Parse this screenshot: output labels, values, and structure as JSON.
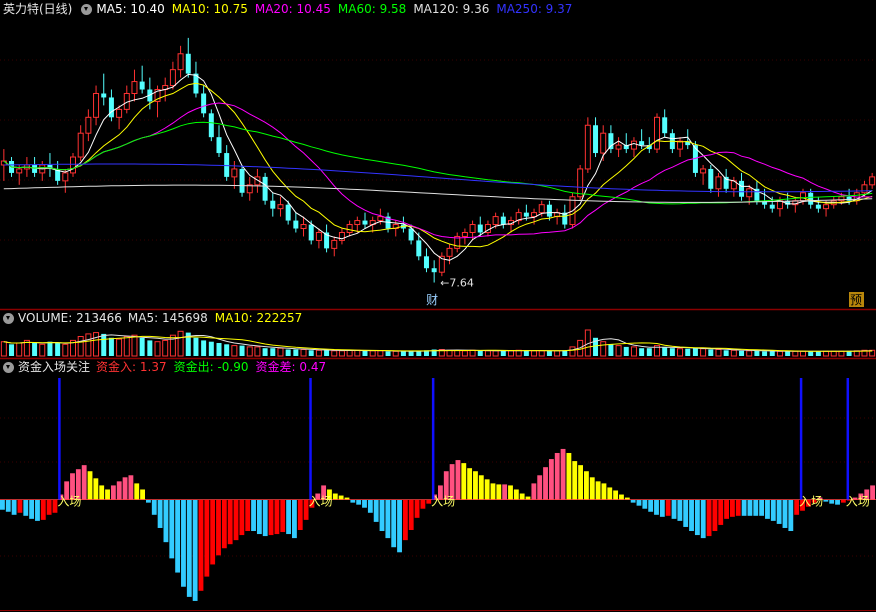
{
  "colors": {
    "up": "#ff3232",
    "down": "#54ffff",
    "bg": "#000000",
    "ma5": "#ffffff",
    "ma10": "#ffff00",
    "ma20": "#ff00ff",
    "ma60": "#00ff00",
    "ma120": "#e0e0e0",
    "ma250": "#3333ff",
    "in": "#ff3232",
    "out": "#00ff00",
    "diff": "#ff00ff",
    "signal": "#1010ff",
    "divider": "#8b0000",
    "grid": "#7a0000"
  },
  "main_legend": {
    "title": "英力特(日线)",
    "items": [
      {
        "text": "MA5: 10.40",
        "color": "#ffffff"
      },
      {
        "text": "MA10: 10.75",
        "color": "#ffff00"
      },
      {
        "text": "MA20: 10.45",
        "color": "#ff00ff"
      },
      {
        "text": "MA60: 9.58",
        "color": "#00ff00"
      },
      {
        "text": "MA120: 9.36",
        "color": "#e0e0e0"
      },
      {
        "text": "MA250: 9.37",
        "color": "#3333ff"
      }
    ]
  },
  "volume_legend": {
    "title": "VOLUME: 213466",
    "items": [
      {
        "text": "MA5: 145698",
        "color": "#e0e0e0"
      },
      {
        "text": "MA10: 222257",
        "color": "#ffff00"
      }
    ]
  },
  "fund_legend": {
    "title": "资金入场关注",
    "items": [
      {
        "text": "资金入: 1.37",
        "color": "#ff3232"
      },
      {
        "text": "资金出: -0.90",
        "color": "#00ff00"
      },
      {
        "text": "资金差: 0.47",
        "color": "#ff00ff"
      }
    ]
  },
  "annotations": {
    "low_price": "←7.64",
    "cai_marker": "财",
    "yu_marker": "预",
    "entry_label": "入场"
  },
  "chart_data": {
    "type": "candlestick",
    "price_range": [
      7.2,
      14.2
    ],
    "candles": [
      [
        10.6,
        11.0,
        10.2,
        10.7
      ],
      [
        10.7,
        10.8,
        10.3,
        10.4
      ],
      [
        10.4,
        10.6,
        10.1,
        10.5
      ],
      [
        10.5,
        10.8,
        10.3,
        10.6
      ],
      [
        10.6,
        10.8,
        10.3,
        10.4
      ],
      [
        10.4,
        10.7,
        10.2,
        10.6
      ],
      [
        10.6,
        10.9,
        10.3,
        10.5
      ],
      [
        10.5,
        10.7,
        10.1,
        10.2
      ],
      [
        10.2,
        10.5,
        9.9,
        10.4
      ],
      [
        10.4,
        10.9,
        10.3,
        10.8
      ],
      [
        10.8,
        11.6,
        10.7,
        11.4
      ],
      [
        11.4,
        12.0,
        11.2,
        11.8
      ],
      [
        11.8,
        12.6,
        11.6,
        12.4
      ],
      [
        12.4,
        12.9,
        12.1,
        12.3
      ],
      [
        12.3,
        12.5,
        11.7,
        11.8
      ],
      [
        11.8,
        12.1,
        11.5,
        12.0
      ],
      [
        12.0,
        12.6,
        11.9,
        12.4
      ],
      [
        12.4,
        13.0,
        12.2,
        12.7
      ],
      [
        12.7,
        13.1,
        12.4,
        12.5
      ],
      [
        12.5,
        12.8,
        12.0,
        12.2
      ],
      [
        12.2,
        12.6,
        11.8,
        12.5
      ],
      [
        12.5,
        12.8,
        12.2,
        12.6
      ],
      [
        12.6,
        13.2,
        12.5,
        13.0
      ],
      [
        13.0,
        13.6,
        12.8,
        13.4
      ],
      [
        13.4,
        13.8,
        12.8,
        12.9
      ],
      [
        12.9,
        13.2,
        12.3,
        12.4
      ],
      [
        12.4,
        12.6,
        11.8,
        11.9
      ],
      [
        11.9,
        12.0,
        11.2,
        11.3
      ],
      [
        11.3,
        11.6,
        10.8,
        10.9
      ],
      [
        10.9,
        11.1,
        10.2,
        10.3
      ],
      [
        10.3,
        10.7,
        10.0,
        10.5
      ],
      [
        10.5,
        10.6,
        9.8,
        9.9
      ],
      [
        9.9,
        10.3,
        9.7,
        10.1
      ],
      [
        10.1,
        10.5,
        9.9,
        10.3
      ],
      [
        10.3,
        10.4,
        9.6,
        9.7
      ],
      [
        9.7,
        9.9,
        9.3,
        9.5
      ],
      [
        9.5,
        9.8,
        9.3,
        9.6
      ],
      [
        9.6,
        9.7,
        9.1,
        9.2
      ],
      [
        9.2,
        9.4,
        8.9,
        9.0
      ],
      [
        9.0,
        9.3,
        8.8,
        9.1
      ],
      [
        9.1,
        9.2,
        8.6,
        8.7
      ],
      [
        8.7,
        9.0,
        8.5,
        8.9
      ],
      [
        8.9,
        9.1,
        8.4,
        8.5
      ],
      [
        8.5,
        8.8,
        8.3,
        8.7
      ],
      [
        8.7,
        9.0,
        8.6,
        8.9
      ],
      [
        8.9,
        9.2,
        8.8,
        9.1
      ],
      [
        9.1,
        9.3,
        8.9,
        9.2
      ],
      [
        9.2,
        9.4,
        9.0,
        9.1
      ],
      [
        9.1,
        9.3,
        8.9,
        9.2
      ],
      [
        9.2,
        9.5,
        9.1,
        9.3
      ],
      [
        9.3,
        9.4,
        8.9,
        9.0
      ],
      [
        9.0,
        9.2,
        8.8,
        9.1
      ],
      [
        9.1,
        9.3,
        8.9,
        9.0
      ],
      [
        9.0,
        9.1,
        8.6,
        8.7
      ],
      [
        8.7,
        8.9,
        8.2,
        8.3
      ],
      [
        8.3,
        8.5,
        7.9,
        8.0
      ],
      [
        8.0,
        8.2,
        7.64,
        7.9
      ],
      [
        7.9,
        8.4,
        7.8,
        8.3
      ],
      [
        8.3,
        8.6,
        8.1,
        8.5
      ],
      [
        8.5,
        8.9,
        8.4,
        8.8
      ],
      [
        8.8,
        9.0,
        8.6,
        8.9
      ],
      [
        8.9,
        9.2,
        8.7,
        9.1
      ],
      [
        9.1,
        9.3,
        8.8,
        8.9
      ],
      [
        8.9,
        9.2,
        8.8,
        9.1
      ],
      [
        9.1,
        9.4,
        9.0,
        9.3
      ],
      [
        9.3,
        9.4,
        9.0,
        9.1
      ],
      [
        9.1,
        9.3,
        8.9,
        9.2
      ],
      [
        9.2,
        9.5,
        9.1,
        9.4
      ],
      [
        9.4,
        9.6,
        9.2,
        9.3
      ],
      [
        9.3,
        9.5,
        9.1,
        9.4
      ],
      [
        9.4,
        9.7,
        9.3,
        9.6
      ],
      [
        9.6,
        9.7,
        9.2,
        9.3
      ],
      [
        9.3,
        9.5,
        9.1,
        9.4
      ],
      [
        9.4,
        9.6,
        9.0,
        9.1
      ],
      [
        9.1,
        9.9,
        9.0,
        9.8
      ],
      [
        9.8,
        10.6,
        9.7,
        10.5
      ],
      [
        10.5,
        11.8,
        10.4,
        11.6
      ],
      [
        11.6,
        11.8,
        10.8,
        10.9
      ],
      [
        10.9,
        11.6,
        10.7,
        11.4
      ],
      [
        11.4,
        11.6,
        10.9,
        11.0
      ],
      [
        11.0,
        11.3,
        10.8,
        11.1
      ],
      [
        11.1,
        11.4,
        10.9,
        11.0
      ],
      [
        11.0,
        11.3,
        10.8,
        11.2
      ],
      [
        11.2,
        11.5,
        11.0,
        11.1
      ],
      [
        11.1,
        11.3,
        10.9,
        11.0
      ],
      [
        11.0,
        11.9,
        10.9,
        11.8
      ],
      [
        11.8,
        12.0,
        11.3,
        11.4
      ],
      [
        11.4,
        11.5,
        10.9,
        11.0
      ],
      [
        11.0,
        11.3,
        10.8,
        11.2
      ],
      [
        11.2,
        11.5,
        11.0,
        11.1
      ],
      [
        11.1,
        11.2,
        10.3,
        10.4
      ],
      [
        10.4,
        10.6,
        10.1,
        10.5
      ],
      [
        10.5,
        10.6,
        9.9,
        10.0
      ],
      [
        10.0,
        10.4,
        9.8,
        10.3
      ],
      [
        10.3,
        10.5,
        9.9,
        10.0
      ],
      [
        10.0,
        10.3,
        9.8,
        10.2
      ],
      [
        10.2,
        10.4,
        9.7,
        9.8
      ],
      [
        9.8,
        10.1,
        9.6,
        10.0
      ],
      [
        10.0,
        10.2,
        9.6,
        9.7
      ],
      [
        9.7,
        10.0,
        9.5,
        9.6
      ],
      [
        9.6,
        9.8,
        9.4,
        9.5
      ],
      [
        9.5,
        9.8,
        9.3,
        9.7
      ],
      [
        9.7,
        9.9,
        9.5,
        9.6
      ],
      [
        9.6,
        9.8,
        9.4,
        9.7
      ],
      [
        9.7,
        10.0,
        9.6,
        9.9
      ],
      [
        9.9,
        10.0,
        9.5,
        9.6
      ],
      [
        9.6,
        9.8,
        9.4,
        9.5
      ],
      [
        9.5,
        9.7,
        9.3,
        9.6
      ],
      [
        9.6,
        9.8,
        9.5,
        9.7
      ],
      [
        9.7,
        9.9,
        9.6,
        9.8
      ],
      [
        9.8,
        10.0,
        9.6,
        9.7
      ],
      [
        9.7,
        10.0,
        9.6,
        9.9
      ],
      [
        9.9,
        10.2,
        9.8,
        10.1
      ],
      [
        10.1,
        10.4,
        10.0,
        10.3
      ]
    ],
    "volumes": [
      0.55,
      0.45,
      0.5,
      0.6,
      0.5,
      0.45,
      0.55,
      0.5,
      0.45,
      0.6,
      0.75,
      0.85,
      0.9,
      0.85,
      0.7,
      0.65,
      0.75,
      0.8,
      0.7,
      0.6,
      0.55,
      0.6,
      0.8,
      0.95,
      0.9,
      0.7,
      0.6,
      0.55,
      0.5,
      0.45,
      0.4,
      0.4,
      0.35,
      0.35,
      0.3,
      0.3,
      0.3,
      0.25,
      0.25,
      0.25,
      0.22,
      0.22,
      0.22,
      0.2,
      0.2,
      0.22,
      0.22,
      0.2,
      0.2,
      0.2,
      0.18,
      0.18,
      0.18,
      0.18,
      0.2,
      0.22,
      0.25,
      0.25,
      0.22,
      0.22,
      0.2,
      0.22,
      0.2,
      0.2,
      0.2,
      0.2,
      0.2,
      0.22,
      0.22,
      0.2,
      0.2,
      0.2,
      0.2,
      0.22,
      0.35,
      0.6,
      1.0,
      0.7,
      0.55,
      0.45,
      0.4,
      0.35,
      0.35,
      0.3,
      0.3,
      0.4,
      0.35,
      0.3,
      0.28,
      0.28,
      0.3,
      0.28,
      0.25,
      0.25,
      0.22,
      0.22,
      0.2,
      0.2,
      0.2,
      0.18,
      0.18,
      0.18,
      0.18,
      0.18,
      0.18,
      0.18,
      0.18,
      0.18,
      0.18,
      0.18,
      0.2,
      0.2,
      0.22,
      0.22
    ],
    "fund_bars": [
      -1.0,
      -1.2,
      -1.5,
      -1.3,
      -1.6,
      -1.9,
      -2.1,
      -2.0,
      -1.5,
      -1.3,
      0.5,
      1.8,
      2.6,
      3.0,
      3.4,
      2.8,
      2.1,
      1.4,
      1.0,
      1.4,
      1.8,
      2.2,
      2.4,
      1.6,
      1.0,
      -0.3,
      -1.5,
      -2.8,
      -4.2,
      -5.8,
      -7.2,
      -8.6,
      -9.6,
      -10.0,
      -9.0,
      -7.6,
      -6.4,
      -5.5,
      -4.8,
      -4.4,
      -4.0,
      -3.5,
      -3.1,
      -3.1,
      -3.4,
      -3.6,
      -3.5,
      -3.4,
      -3.2,
      -3.4,
      -3.8,
      -3.0,
      -2.0,
      -0.8,
      0.6,
      1.4,
      1.0,
      0.6,
      0.4,
      0.2,
      -0.3,
      -0.5,
      -0.8,
      -1.3,
      -2.2,
      -3.1,
      -3.8,
      -4.7,
      -5.2,
      -4.0,
      -3.0,
      -1.8,
      -0.9,
      -0.4,
      0.5,
      1.4,
      2.8,
      3.5,
      3.9,
      3.6,
      3.1,
      2.8,
      2.4,
      2.0,
      1.6,
      1.5,
      1.5,
      1.4,
      1.0,
      0.6,
      0.3,
      1.6,
      2.4,
      3.2,
      4.0,
      4.6,
      5.0,
      4.6,
      3.8,
      3.4,
      2.8,
      2.2,
      1.8,
      1.6,
      1.2,
      0.9,
      0.5,
      0.2,
      -0.3,
      -0.6,
      -0.9,
      -1.2,
      -1.5,
      -1.7,
      -1.6,
      -1.9,
      -2.1,
      -2.7,
      -3.1,
      -3.5,
      -3.8,
      -3.6,
      -3.1,
      -2.5,
      -1.9,
      -1.7,
      -1.6,
      -1.6,
      -1.6,
      -1.6,
      -1.6,
      -1.9,
      -2.1,
      -2.4,
      -2.8,
      -3.1,
      -1.5,
      -1.1,
      -0.7,
      -0.3,
      0.2,
      -0.2,
      -0.4,
      -0.5,
      -0.3,
      -0.1,
      0.2,
      0.6,
      1.0,
      1.4
    ],
    "fund_range": [
      -10.5,
      12.0
    ],
    "entry_signals": [
      10,
      53,
      74,
      137,
      145
    ],
    "entry_signal_height": 12.0
  }
}
